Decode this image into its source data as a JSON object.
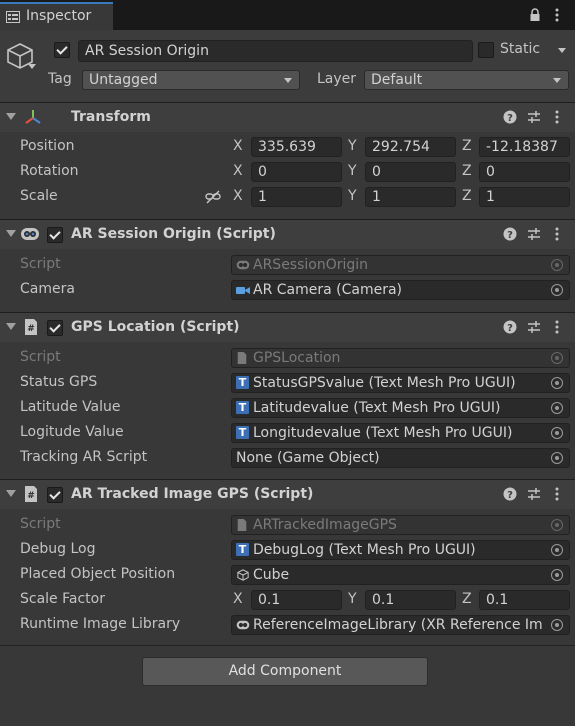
{
  "tab": {
    "label": "Inspector",
    "icon": "info-icon"
  },
  "header": {
    "name": "AR Session Origin",
    "static_label": "Static",
    "tag_label": "Tag",
    "tag_value": "Untagged",
    "layer_label": "Layer",
    "layer_value": "Default"
  },
  "transform": {
    "title": "Transform",
    "position_label": "Position",
    "rotation_label": "Rotation",
    "scale_label": "Scale",
    "axis_x": "X",
    "axis_y": "Y",
    "axis_z": "Z",
    "position": [
      "335.639",
      "292.754",
      "-12.18387"
    ],
    "rotation": [
      "0",
      "0",
      "0"
    ],
    "scale": [
      "1",
      "1",
      "1"
    ]
  },
  "ar_session_origin": {
    "title": "AR Session Origin (Script)",
    "script_label": "Script",
    "script_value": "ARSessionOrigin",
    "camera_label": "Camera",
    "camera_value": "AR Camera (Camera)"
  },
  "gps_location": {
    "title": "GPS Location (Script)",
    "script_label": "Script",
    "script_value": "GPSLocation",
    "status_label": "Status GPS",
    "status_value": "StatusGPSvalue (Text Mesh Pro UGUI)",
    "lat_label": "Latitude Value",
    "lat_value": "Latitudevalue (Text Mesh Pro UGUI)",
    "lon_label": "Logitude Value",
    "lon_value": "Longitudevalue (Text Mesh Pro UGUI)",
    "tracking_label": "Tracking AR Script",
    "tracking_value": "None (Game Object)",
    "tmp_glyph": "T"
  },
  "tracked_image": {
    "title": "AR Tracked Image GPS (Script)",
    "script_label": "Script",
    "script_value": "ARTrackedImageGPS",
    "debug_label": "Debug Log",
    "debug_value": "DebugLog (Text Mesh Pro UGUI)",
    "placed_label": "Placed Object Position",
    "placed_value": "Cube",
    "scale_label": "Scale Factor",
    "scale": [
      "0.1",
      "0.1",
      "0.1"
    ],
    "library_label": "Runtime Image Library",
    "library_value": "ReferenceImageLibrary (XR Reference Im"
  },
  "add_component": "Add Component",
  "colors": {
    "tab_accent": "#3a79bb",
    "tmp_icon": "#3d6fb5",
    "transform_x": "#e0533f",
    "transform_y": "#7ec35a",
    "transform_z": "#4a86d8"
  }
}
